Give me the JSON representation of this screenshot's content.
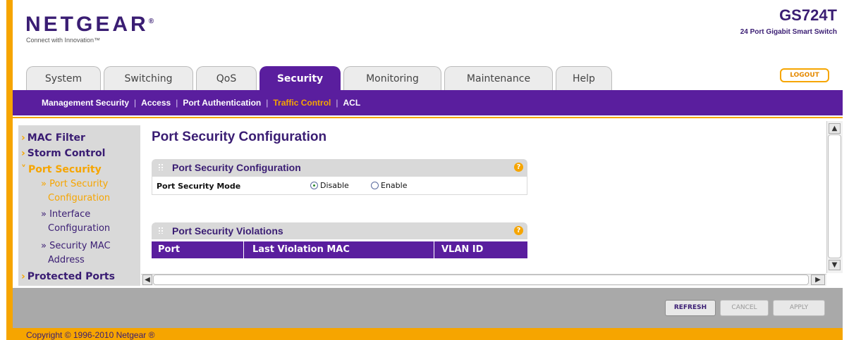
{
  "header": {
    "logo": "NETGEAR",
    "registered_mark": "®",
    "tagline": "Connect with Innovation™",
    "model": "GS724T",
    "subtitle": "24 Port Gigabit Smart Switch",
    "logout_label": "LOGOUT"
  },
  "tabs": [
    {
      "label": "System"
    },
    {
      "label": "Switching"
    },
    {
      "label": "QoS"
    },
    {
      "label": "Security",
      "active": true
    },
    {
      "label": "Monitoring"
    },
    {
      "label": "Maintenance"
    },
    {
      "label": "Help"
    }
  ],
  "subnav": [
    {
      "label": "Management Security"
    },
    {
      "label": "Access"
    },
    {
      "label": "Port Authentication"
    },
    {
      "label": "Traffic Control",
      "current": true
    },
    {
      "label": "ACL"
    }
  ],
  "sidebar": [
    {
      "label": "MAC Filter",
      "type": "main"
    },
    {
      "label": "Storm Control",
      "type": "main"
    },
    {
      "label": "Port Security",
      "type": "main",
      "expanded": true
    },
    {
      "label_line1": "» Port Security",
      "label_line2": "Configuration",
      "type": "sub",
      "current": true
    },
    {
      "label_line1": "» Interface",
      "label_line2": "Configuration",
      "type": "sub"
    },
    {
      "label_line1": "» Security MAC",
      "label_line2": "Address",
      "type": "sub"
    },
    {
      "label": "Protected Ports",
      "type": "main"
    }
  ],
  "main": {
    "page_title": "Port Security Configuration",
    "config_panel": {
      "title": "Port Security Configuration",
      "help": "?",
      "mode_label": "Port Security Mode",
      "options": [
        "Disable",
        "Enable"
      ],
      "selected": "Disable"
    },
    "violations_panel": {
      "title": "Port Security Violations",
      "help": "?",
      "columns": [
        "Port",
        "Last Violation MAC",
        "VLAN ID"
      ],
      "rows": []
    }
  },
  "buttons": {
    "refresh": "REFRESH",
    "cancel": "CANCEL",
    "apply": "APPLY"
  },
  "footer": {
    "copyright": "Copyright © 1996-2010 Netgear ®"
  },
  "colors": {
    "purple": "#5a1e9e",
    "orange": "#f6a500",
    "dark_purple_text": "#3a1d73"
  }
}
